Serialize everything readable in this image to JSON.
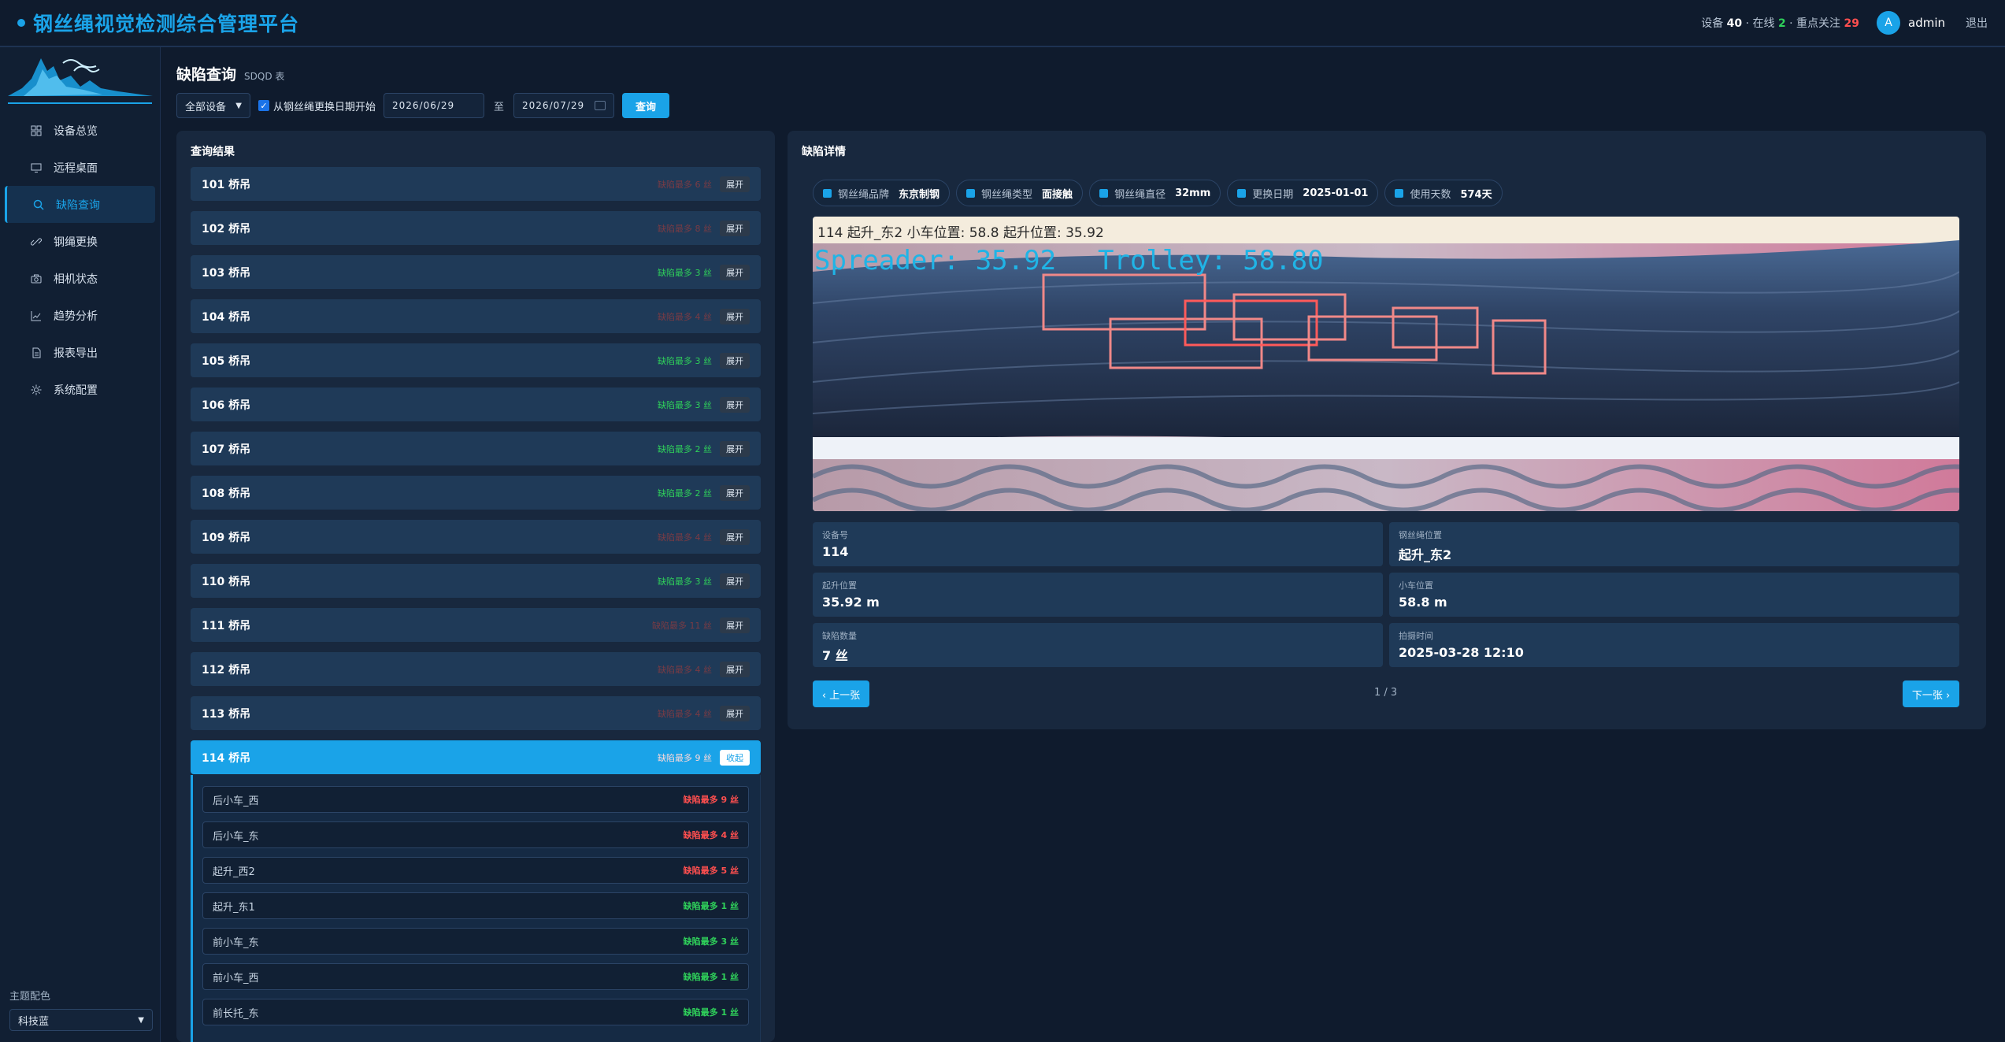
{
  "app": {
    "title": "钢丝绳视觉检测综合管理平台"
  },
  "header": {
    "stats_prefix": "设备",
    "device_count": "40",
    "online_label": "· 在线",
    "online_count": "2",
    "focus_label": "· 重点关注",
    "focus_count": "29",
    "avatar_letter": "A",
    "username": "admin",
    "logout": "退出"
  },
  "sidebar": {
    "items": [
      {
        "label": "设备总览",
        "icon": "grid-icon"
      },
      {
        "label": "远程桌面",
        "icon": "monitor-icon"
      },
      {
        "label": "缺陷查询",
        "icon": "search-icon"
      },
      {
        "label": "钢绳更换",
        "icon": "link-icon"
      },
      {
        "label": "相机状态",
        "icon": "camera-icon"
      },
      {
        "label": "趋势分析",
        "icon": "chart-icon"
      },
      {
        "label": "报表导出",
        "icon": "file-icon"
      },
      {
        "label": "系统配置",
        "icon": "gear-icon"
      }
    ],
    "theme_label": "主题配色",
    "theme_value": "科技蓝"
  },
  "page": {
    "title": "缺陷查询",
    "subtitle": "SDQD 表"
  },
  "filters": {
    "device_select": "全部设备",
    "checkbox_label": "从钢丝绳更换日期开始",
    "date_from": "2026/06/29",
    "to_label": "至",
    "date_to": "2026/07/29",
    "query_button": "查询"
  },
  "results": {
    "title": "查询结果",
    "rows": [
      {
        "name": "101 桥吊",
        "count": "缺陷最多 6 丝",
        "status": "red",
        "toggle": "展开"
      },
      {
        "name": "102 桥吊",
        "count": "缺陷最多 8 丝",
        "status": "red",
        "toggle": "展开"
      },
      {
        "name": "103 桥吊",
        "count": "缺陷最多 3 丝",
        "status": "green",
        "toggle": "展开"
      },
      {
        "name": "104 桥吊",
        "count": "缺陷最多 4 丝",
        "status": "red",
        "toggle": "展开"
      },
      {
        "name": "105 桥吊",
        "count": "缺陷最多 3 丝",
        "status": "green",
        "toggle": "展开"
      },
      {
        "name": "106 桥吊",
        "count": "缺陷最多 3 丝",
        "status": "green",
        "toggle": "展开"
      },
      {
        "name": "107 桥吊",
        "count": "缺陷最多 2 丝",
        "status": "green",
        "toggle": "展开"
      },
      {
        "name": "108 桥吊",
        "count": "缺陷最多 2 丝",
        "status": "green",
        "toggle": "展开"
      },
      {
        "name": "109 桥吊",
        "count": "缺陷最多 4 丝",
        "status": "red",
        "toggle": "展开"
      },
      {
        "name": "110 桥吊",
        "count": "缺陷最多 3 丝",
        "status": "green",
        "toggle": "展开"
      },
      {
        "name": "111 桥吊",
        "count": "缺陷最多 11 丝",
        "status": "red",
        "toggle": "展开"
      },
      {
        "name": "112 桥吊",
        "count": "缺陷最多 4 丝",
        "status": "red",
        "toggle": "展开"
      },
      {
        "name": "113 桥吊",
        "count": "缺陷最多 4 丝",
        "status": "red",
        "toggle": "展开"
      },
      {
        "name": "114 桥吊",
        "count": "缺陷最多 9 丝",
        "status": "red",
        "toggle": "收起",
        "expanded": true
      }
    ],
    "subrows": [
      {
        "name": "后小车_西",
        "count": "缺陷最多 9 丝",
        "status": "red"
      },
      {
        "name": "后小车_东",
        "count": "缺陷最多 4 丝",
        "status": "red"
      },
      {
        "name": "起升_西2",
        "count": "缺陷最多 5 丝",
        "status": "red"
      },
      {
        "name": "起升_东1",
        "count": "缺陷最多 1 丝",
        "status": "green"
      },
      {
        "name": "前小车_东",
        "count": "缺陷最多 3 丝",
        "status": "green"
      },
      {
        "name": "前小车_西",
        "count": "缺陷最多 1 丝",
        "status": "green"
      },
      {
        "name": "前长托_东",
        "count": "缺陷最多 1 丝",
        "status": "green"
      }
    ]
  },
  "detail": {
    "title": "缺陷详情",
    "tags": [
      {
        "key": "钢丝绳品牌",
        "value": "东京制钢"
      },
      {
        "key": "钢丝绳类型",
        "value": "面接触"
      },
      {
        "key": "钢丝绳直径",
        "value": "32mm"
      },
      {
        "key": "更换日期",
        "value": "2025-01-01"
      },
      {
        "key": "使用天数",
        "value": "574天"
      }
    ],
    "image_caption": "114  起升_东2  小车位置: 58.8  起升位置: 35.92",
    "overlay_spreader": "Spreader: 35.92",
    "overlay_trolley": "Trolley: 58.80",
    "info": [
      {
        "key": "设备号",
        "value": "114"
      },
      {
        "key": "钢丝绳位置",
        "value": "起升_东2"
      },
      {
        "key": "起升位置",
        "value": "35.92 m"
      },
      {
        "key": "小车位置",
        "value": "58.8 m"
      },
      {
        "key": "缺陷数量",
        "value": "7 丝"
      },
      {
        "key": "拍摄时间",
        "value": "2025-03-28 12:10"
      }
    ],
    "prev": "‹ 上一张",
    "next": "下一张 ›",
    "pager": "1 / 3"
  },
  "colors": {
    "accent": "#1aa3e8",
    "danger": "#ff4f4f",
    "ok": "#2fd05a",
    "bg": "#0f1b2d"
  }
}
